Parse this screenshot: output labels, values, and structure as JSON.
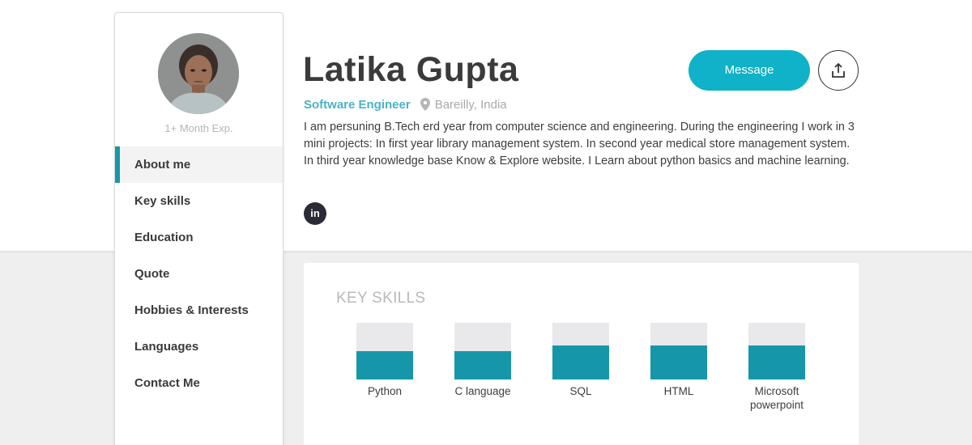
{
  "profile": {
    "name": "Latika Gupta",
    "role": "Software Engineer",
    "location": "Bareilly, India",
    "experience": "1+ Month Exp.",
    "bio": "I am persuning B.Tech erd year from computer science and engineering. During the engineering I work in 3 mini projects: In first year library management system. In second year medical store management system. In third year knowledge base Know & Explore website. I Learn about python basics and machine learning.",
    "linkedin_label": "in"
  },
  "actions": {
    "message_label": "Message",
    "share_icon": "share-icon"
  },
  "sidebar": {
    "items": [
      {
        "label": "About me",
        "active": true
      },
      {
        "label": "Key skills",
        "active": false
      },
      {
        "label": "Education",
        "active": false
      },
      {
        "label": "Quote",
        "active": false
      },
      {
        "label": "Hobbies & Interests",
        "active": false
      },
      {
        "label": "Languages",
        "active": false
      },
      {
        "label": "Contact Me",
        "active": false
      }
    ]
  },
  "skills": {
    "title": "KEY SKILLS",
    "items": [
      {
        "name": "Python",
        "level": 0.5
      },
      {
        "name": "C language",
        "level": 0.5
      },
      {
        "name": "SQL",
        "level": 0.6
      },
      {
        "name": "HTML",
        "level": 0.6
      },
      {
        "name": "Microsoft powerpoint",
        "level": 0.6
      }
    ]
  },
  "colors": {
    "accent": "#1597a9",
    "message_button": "#0fb2c8",
    "role_text": "#4bb3c5"
  }
}
